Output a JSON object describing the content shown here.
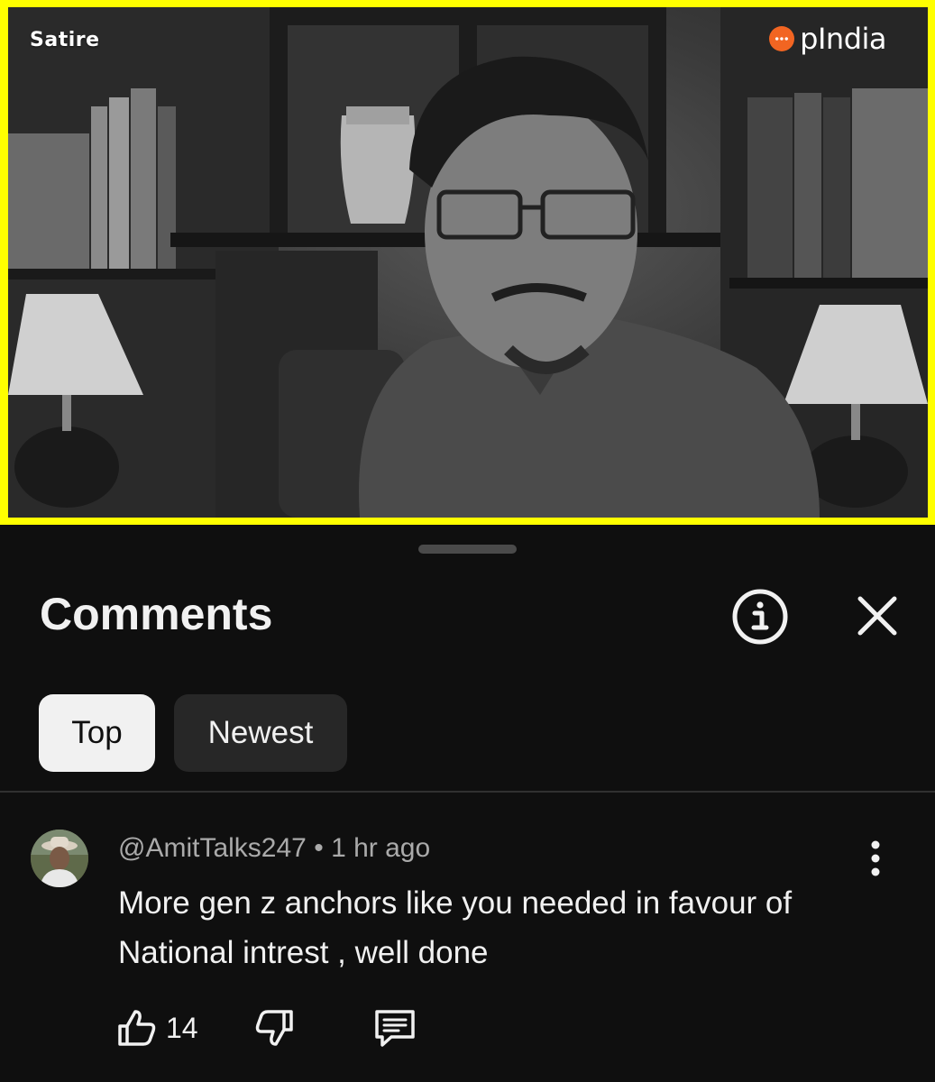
{
  "video": {
    "overlay_label": "Satire",
    "brand_name": "pIndia",
    "border_color": "#ffff00",
    "brand_color": "#f26522"
  },
  "comments_panel": {
    "title": "Comments",
    "info_icon": "info-circle-icon",
    "close_icon": "close-icon",
    "sort_chips": [
      {
        "label": "Top",
        "selected": true
      },
      {
        "label": "Newest",
        "selected": false
      }
    ]
  },
  "comments": [
    {
      "author": "@AmitTalks247",
      "separator": "•",
      "time": "1 hr ago",
      "text": "More gen z anchors like you needed in favour of National intrest , well done",
      "likes": "14",
      "menu_icon": "more-vertical-icon",
      "like_icon": "thumbs-up-icon",
      "dislike_icon": "thumbs-down-icon",
      "reply_icon": "reply-comment-icon"
    }
  ]
}
